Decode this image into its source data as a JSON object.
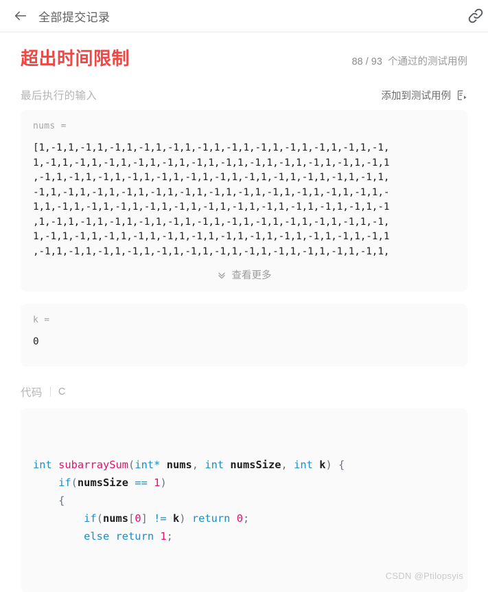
{
  "topbar": {
    "title": "全部提交记录",
    "back_icon": "arrow-left-icon",
    "link_icon": "link-chain-icon"
  },
  "result": {
    "verdict": "超出时间限制",
    "passed": "88",
    "separator": "/",
    "total": "93",
    "testcase_suffix": "个通过的测试用例"
  },
  "input_section": {
    "heading": "最后执行的输入",
    "add_to_testcase_label": "添加到测试用例",
    "add_to_testcase_icon": "file-run-icon",
    "show_more_label": "查看更多",
    "show_more_icon": "double-chevron-down-icon",
    "params": [
      {
        "name": "nums =",
        "lines": [
          "[1,-1,1,-1,1,-1,1,-1,1,-1,1,-1,1,-1,1,-1,1,-1,1,-1,1,-1,1,-1,",
          "1,-1,1,-1,1,-1,1,-1,1,-1,1,-1,1,-1,1,-1,1,-1,1,-1,1,-1,1,-1,1",
          ",-1,1,-1,1,-1,1,-1,1,-1,1,-1,1,-1,1,-1,1,-1,1,-1,1,-1,1,-1,1,",
          "-1,1,-1,1,-1,1,-1,1,-1,1,-1,1,-1,1,-1,1,-1,1,-1,1,-1,1,-1,1,-",
          "1,1,-1,1,-1,1,-1,1,-1,1,-1,1,-1,1,-1,1,-1,1,-1,1,-1,1,-1,1,-1",
          ",1,-1,1,-1,1,-1,1,-1,1,-1,1,-1,1,-1,1,-1,1,-1,1,-1,1,-1,1,-1,",
          "1,-1,1,-1,1,-1,1,-1,1,-1,1,-1,1,-1,1,-1,1,-1,1,-1,1,-1,1,-1,1",
          ",-1,1,-1,1,-1,1,-1,1,-1,1,-1,1,-1,1,-1,1,-1,1,-1,1,-1,1,-1,1,"
        ],
        "has_show_more": true
      },
      {
        "name": "k =",
        "lines": [
          "0"
        ],
        "has_show_more": false
      }
    ]
  },
  "code_section": {
    "title": "代码",
    "language": "C",
    "lines": [
      [
        {
          "t": "int",
          "c": "kw"
        },
        {
          "t": " ",
          "c": "plain"
        },
        {
          "t": "subarraySum",
          "c": "fn"
        },
        {
          "t": "(",
          "c": "punc"
        },
        {
          "t": "int",
          "c": "kw"
        },
        {
          "t": "*",
          "c": "op"
        },
        {
          "t": " ",
          "c": "plain"
        },
        {
          "t": "nums",
          "c": "id"
        },
        {
          "t": ", ",
          "c": "punc"
        },
        {
          "t": "int",
          "c": "kw"
        },
        {
          "t": " ",
          "c": "plain"
        },
        {
          "t": "numsSize",
          "c": "id"
        },
        {
          "t": ", ",
          "c": "punc"
        },
        {
          "t": "int",
          "c": "kw"
        },
        {
          "t": " ",
          "c": "plain"
        },
        {
          "t": "k",
          "c": "id"
        },
        {
          "t": ") ",
          "c": "punc"
        },
        {
          "t": "{",
          "c": "punc"
        }
      ],
      [
        {
          "t": "    ",
          "c": "plain"
        },
        {
          "t": "if",
          "c": "kw"
        },
        {
          "t": "(",
          "c": "punc"
        },
        {
          "t": "numsSize",
          "c": "id"
        },
        {
          "t": " ",
          "c": "plain"
        },
        {
          "t": "==",
          "c": "op"
        },
        {
          "t": " ",
          "c": "plain"
        },
        {
          "t": "1",
          "c": "num"
        },
        {
          "t": ")",
          "c": "punc"
        }
      ],
      [
        {
          "t": "    ",
          "c": "plain"
        },
        {
          "t": "{",
          "c": "punc"
        }
      ],
      [
        {
          "t": "        ",
          "c": "plain"
        },
        {
          "t": "if",
          "c": "kw"
        },
        {
          "t": "(",
          "c": "punc"
        },
        {
          "t": "nums",
          "c": "id"
        },
        {
          "t": "[",
          "c": "punc"
        },
        {
          "t": "0",
          "c": "num"
        },
        {
          "t": "] ",
          "c": "punc"
        },
        {
          "t": "!=",
          "c": "op"
        },
        {
          "t": " ",
          "c": "plain"
        },
        {
          "t": "k",
          "c": "id"
        },
        {
          "t": ") ",
          "c": "punc"
        },
        {
          "t": "return",
          "c": "kw"
        },
        {
          "t": " ",
          "c": "plain"
        },
        {
          "t": "0",
          "c": "num"
        },
        {
          "t": ";",
          "c": "punc"
        }
      ],
      [
        {
          "t": "        ",
          "c": "plain"
        },
        {
          "t": "else",
          "c": "kw"
        },
        {
          "t": " ",
          "c": "plain"
        },
        {
          "t": "return",
          "c": "kw"
        },
        {
          "t": " ",
          "c": "plain"
        },
        {
          "t": "1",
          "c": "num"
        },
        {
          "t": ";",
          "c": "punc"
        }
      ]
    ]
  },
  "watermark": "CSDN @Ptilopsyis",
  "colors": {
    "verdict_red": "#ef4743",
    "panel_bg": "#fafafa",
    "keyword_blue": "#1a8fc4",
    "function_pink": "#e3116c",
    "muted_gray": "#b5b5b5"
  }
}
